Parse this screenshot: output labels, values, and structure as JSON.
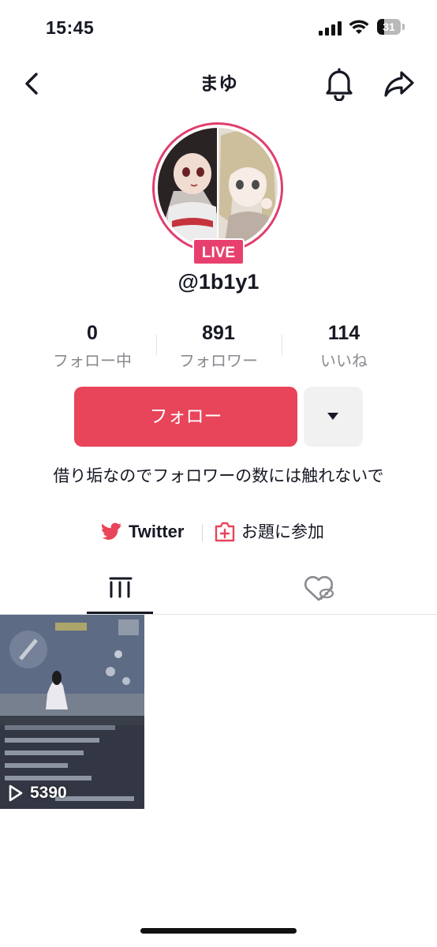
{
  "status_bar": {
    "time": "15:45",
    "battery_level": "31",
    "battery_fraction": 0.31
  },
  "nav": {
    "title": "まゆ",
    "icons": [
      "chevron-left-icon",
      "bell-icon",
      "share-icon"
    ]
  },
  "profile": {
    "live_badge": "LIVE",
    "username": "@1b1y1",
    "accent_color": "#e03f6d"
  },
  "stats": [
    {
      "value": "0",
      "label": "フォロー中"
    },
    {
      "value": "891",
      "label": "フォロワー"
    },
    {
      "value": "114",
      "label": "いいね"
    }
  ],
  "actions": {
    "follow_label": "フォロー",
    "follow_color": "#e8445a"
  },
  "bio": {
    "text": "借り垢なのでフォロワーの数には触れないで"
  },
  "links": {
    "twitter_label": "Twitter",
    "topic_label": "お題に参加"
  },
  "tabs": [
    "grid-icon",
    "hidden-liked-icon"
  ],
  "videos": [
    {
      "play_count": "5390"
    }
  ]
}
